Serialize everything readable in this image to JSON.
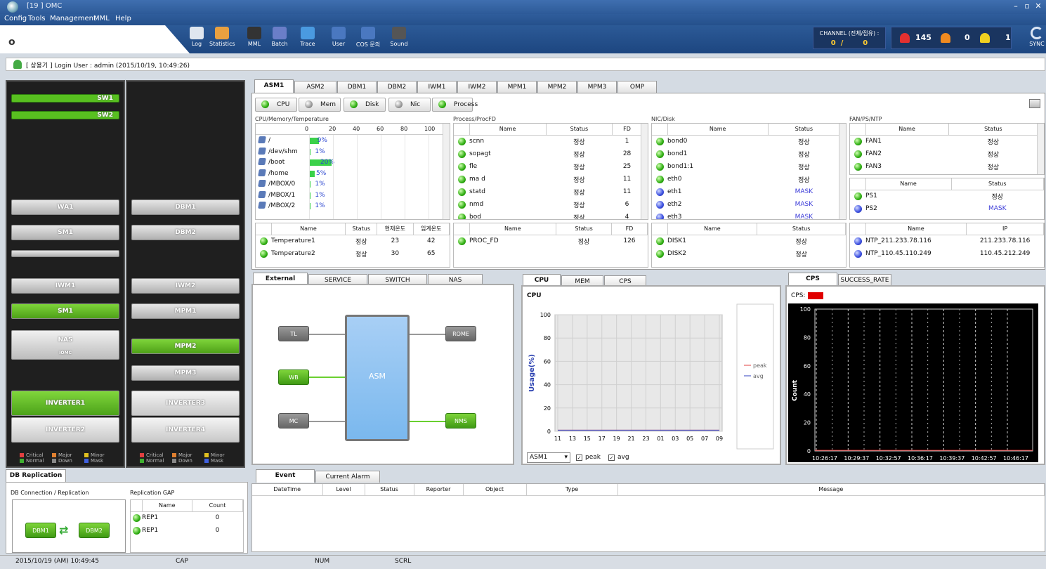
{
  "window": {
    "title": "[19          ] OMC"
  },
  "menu": [
    "Config",
    "Tools",
    "Management",
    "MML",
    "Help"
  ],
  "toolbar": [
    {
      "label": "Log",
      "icon": "log-icon",
      "color": "#dfe6ef"
    },
    {
      "label": "Statistics",
      "icon": "statistics-icon",
      "color": "#e8a040"
    },
    {
      "label": "MML",
      "icon": "mml-icon",
      "color": "#333"
    },
    {
      "label": "Batch",
      "icon": "batch-icon",
      "color": "#6a7ec8"
    },
    {
      "label": "Trace",
      "icon": "trace-icon",
      "color": "#4a9ae0"
    },
    {
      "label": "User",
      "icon": "user-gear-icon",
      "color": "#4a78c0"
    },
    {
      "label": "COS 문의",
      "icon": "cos-gear-icon",
      "color": "#4a78c0"
    },
    {
      "label": "Sound",
      "icon": "sound-icon",
      "color": "#555"
    }
  ],
  "channel": {
    "label": "CHANNEL (전체/점유) :",
    "total": "0",
    "sep": "/",
    "used": "0"
  },
  "alarms": {
    "critical": "145",
    "major": "0",
    "minor": "1"
  },
  "sync_label": "SYNC",
  "login": {
    "text": "[ 상용기 ] Login User : admin (2015/10/19, 10:49:26)"
  },
  "rack1": {
    "switches": [
      "SW1",
      "SW2"
    ],
    "servers": [
      {
        "label": "WA1",
        "green": false
      },
      {
        "label": "SM1",
        "green": false
      },
      {
        "label": "",
        "green": false
      },
      {
        "label": "IWM1",
        "green": false
      },
      {
        "label": "SM1",
        "green": true
      }
    ],
    "nas": {
      "label": "NAS",
      "sub": "IOMC"
    },
    "inverters": [
      {
        "label": "INVERTER1",
        "green": true
      },
      {
        "label": "INVERTER2",
        "green": false
      }
    ]
  },
  "rack2": {
    "servers": [
      {
        "label": "DBM1",
        "green": false
      },
      {
        "label": "DBM2",
        "green": false
      },
      {
        "label": "IWM2",
        "green": false
      },
      {
        "label": "MPM1",
        "green": false
      },
      {
        "label": "MPM2",
        "green": true
      },
      {
        "label": "MPM3",
        "green": false
      }
    ],
    "inverters": [
      {
        "label": "INVERTER3",
        "green": false
      },
      {
        "label": "INVERTER4",
        "green": false
      }
    ]
  },
  "legend": [
    {
      "label": "Critical",
      "color": "#e04040"
    },
    {
      "label": "Major",
      "color": "#e08030"
    },
    {
      "label": "Minor",
      "color": "#e0c020"
    },
    {
      "label": "Normal",
      "color": "#40b030"
    },
    {
      "label": "Down",
      "color": "#888"
    },
    {
      "label": "Mask",
      "color": "#4060e0"
    }
  ],
  "node_tabs": [
    "ASM1",
    "ASM2",
    "DBM1",
    "DBM2",
    "IWM1",
    "IWM2",
    "MPM1",
    "MPM2",
    "MPM3",
    "OMP"
  ],
  "proc_buttons": [
    {
      "label": "CPU",
      "state": "ok"
    },
    {
      "label": "Mem",
      "state": "off"
    },
    {
      "label": "Disk",
      "state": "ok"
    },
    {
      "label": "Nic",
      "state": "off"
    },
    {
      "label": "Process",
      "state": "ok"
    }
  ],
  "cpumem": {
    "title": "CPU/Memory/Temperature",
    "scale": [
      "0",
      "20",
      "40",
      "60",
      "80",
      "100"
    ],
    "rows": [
      {
        "name": "/",
        "pct": 9,
        "label": "9%"
      },
      {
        "name": "/dev/shm",
        "pct": 1,
        "label": "1%"
      },
      {
        "name": "/boot",
        "pct": 20,
        "label": "20%"
      },
      {
        "name": "/home",
        "pct": 5,
        "label": "5%"
      },
      {
        "name": "/MBOX/0",
        "pct": 1,
        "label": "1%"
      },
      {
        "name": "/MBOX/1",
        "pct": 1,
        "label": "1%"
      },
      {
        "name": "/MBOX/2",
        "pct": 1,
        "label": "1%"
      }
    ]
  },
  "temp": {
    "headers": [
      "Name",
      "Status",
      "현재온도",
      "임계온도"
    ],
    "rows": [
      [
        "Temperature1",
        "정상",
        "23",
        "42"
      ],
      [
        "Temperature2",
        "정상",
        "30",
        "65"
      ]
    ]
  },
  "process": {
    "title": "Process/ProcFD",
    "headers": [
      "Name",
      "Status",
      "FD"
    ],
    "rows": [
      [
        "scnn",
        "정상",
        "1"
      ],
      [
        "sopagt",
        "정상",
        "28"
      ],
      [
        "fle",
        "정상",
        "25"
      ],
      [
        "ma d",
        "정상",
        "11"
      ],
      [
        "statd",
        "정상",
        "11"
      ],
      [
        "nmd",
        "정상",
        "6"
      ],
      [
        "bod",
        "정상",
        "4"
      ]
    ]
  },
  "procfd": {
    "headers": [
      "Name",
      "Status",
      "FD"
    ],
    "rows": [
      [
        "PROC_FD",
        "정상",
        "126"
      ]
    ]
  },
  "nic": {
    "title": "NIC/Disk",
    "headers": [
      "Name",
      "Status"
    ],
    "rows": [
      [
        "bond0",
        "정상",
        "ok"
      ],
      [
        "bond1",
        "정상",
        "ok"
      ],
      [
        "bond1:1",
        "정상",
        "ok"
      ],
      [
        "eth0",
        "정상",
        "ok"
      ],
      [
        "eth1",
        "MASK",
        "mask"
      ],
      [
        "eth2",
        "MASK",
        "mask"
      ],
      [
        "eth3",
        "MASK",
        "mask"
      ]
    ]
  },
  "disk": {
    "headers": [
      "Name",
      "Status"
    ],
    "rows": [
      [
        "DISK1",
        "정상"
      ],
      [
        "DISK2",
        "정상"
      ]
    ]
  },
  "fan": {
    "title": "FAN/PS/NTP",
    "headers": [
      "Name",
      "Status"
    ],
    "rows": [
      [
        "FAN1",
        "정상"
      ],
      [
        "FAN2",
        "정상"
      ],
      [
        "FAN3",
        "정상"
      ]
    ]
  },
  "ps": {
    "headers": [
      "Name",
      "Status"
    ],
    "rows": [
      [
        "PS1",
        "정상",
        "ok"
      ],
      [
        "PS2",
        "MASK",
        "mask"
      ]
    ]
  },
  "ntp": {
    "headers": [
      "Name",
      "IP"
    ],
    "rows": [
      [
        "NTP_211.233.78.116",
        "211.233.78.116"
      ],
      [
        "NTP_110.45.110.249",
        "110.45.212.249"
      ]
    ]
  },
  "ext_tabs": [
    "External System",
    "SERVICE",
    "SWITCH",
    "NAS"
  ],
  "ext_nodes": {
    "tl": "TL",
    "wb": "WB",
    "mc": "MC",
    "center": "ASM",
    "rome": "ROME",
    "nms": "NMS"
  },
  "cpu_tabs": [
    "CPU",
    "MEM",
    "CPS"
  ],
  "cps_tabs": [
    "CPS",
    "SUCCESS_RATE"
  ],
  "chart_data": [
    {
      "type": "line",
      "title": "CPU",
      "ylabel": "Usage(%)",
      "ylim": [
        0,
        100
      ],
      "yticks": [
        "0",
        "20",
        "40",
        "60",
        "80",
        "100"
      ],
      "categories": [
        "11",
        "13",
        "15",
        "17",
        "19",
        "21",
        "23",
        "01",
        "03",
        "05",
        "07",
        "09"
      ],
      "series": [
        {
          "name": "peak",
          "color": "#e04040",
          "values": [
            1,
            1,
            1,
            1,
            1,
            1,
            1,
            1,
            1,
            1,
            1,
            1
          ]
        },
        {
          "name": "avg",
          "color": "#3040c0",
          "values": [
            1,
            1,
            1,
            1,
            1,
            1,
            1,
            1,
            1,
            1,
            1,
            1
          ]
        }
      ],
      "grid": true,
      "legend": "right"
    },
    {
      "type": "line",
      "title": "CPS:",
      "ylabel": "Count",
      "ylim": [
        0,
        100
      ],
      "yticks": [
        "0",
        "20",
        "40",
        "60",
        "80",
        "100"
      ],
      "categories": [
        "10:26:17",
        "10:29:37",
        "10:32:57",
        "10:36:17",
        "10:39:37",
        "10:42:57",
        "10:46:17"
      ],
      "series": [
        {
          "color": "#e02020",
          "values": [
            0,
            0,
            0,
            0,
            0,
            0,
            0
          ]
        }
      ],
      "grid": true
    }
  ],
  "cpu_controls": {
    "select": "ASM1",
    "peak": "peak",
    "avg": "avg"
  },
  "db": {
    "tab": "DB Replication",
    "conn_title": "DB Connection / Replication",
    "gap_title": "Replication GAP",
    "node1": "DBM1",
    "node2": "DBM2",
    "headers": [
      "Name",
      "Count"
    ],
    "rows": [
      [
        "REP1",
        "0"
      ],
      [
        "REP1",
        "0"
      ]
    ]
  },
  "event": {
    "tabs": [
      "Event",
      "Current Alarm"
    ],
    "headers": [
      "DateTime",
      "Level",
      "Status",
      "Reporter",
      "Object",
      "Type",
      "Message"
    ]
  },
  "status": {
    "datetime": "2015/10/19 (AM) 10:49:45",
    "cap": "CAP",
    "num": "NUM",
    "scrl": "SCRL"
  }
}
